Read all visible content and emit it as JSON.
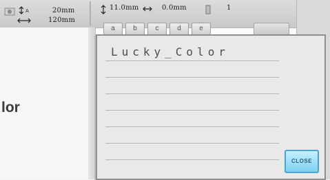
{
  "status": {
    "height_value": "20mm",
    "width_value": "120mm",
    "line_height": "11.0mm",
    "line_spacing": "0.0mm",
    "count": "1"
  },
  "keyboard": {
    "keys": [
      "a",
      "b",
      "c",
      "d",
      "e"
    ]
  },
  "background": {
    "partial_label": "lor"
  },
  "popup": {
    "text": "Lucky_Color",
    "close_label": "CLOSE"
  },
  "colors": {
    "close_button": "#7fd0f2",
    "popup_bg": "#e9e9e9",
    "statusbar_bg": "#d0d0d0"
  }
}
